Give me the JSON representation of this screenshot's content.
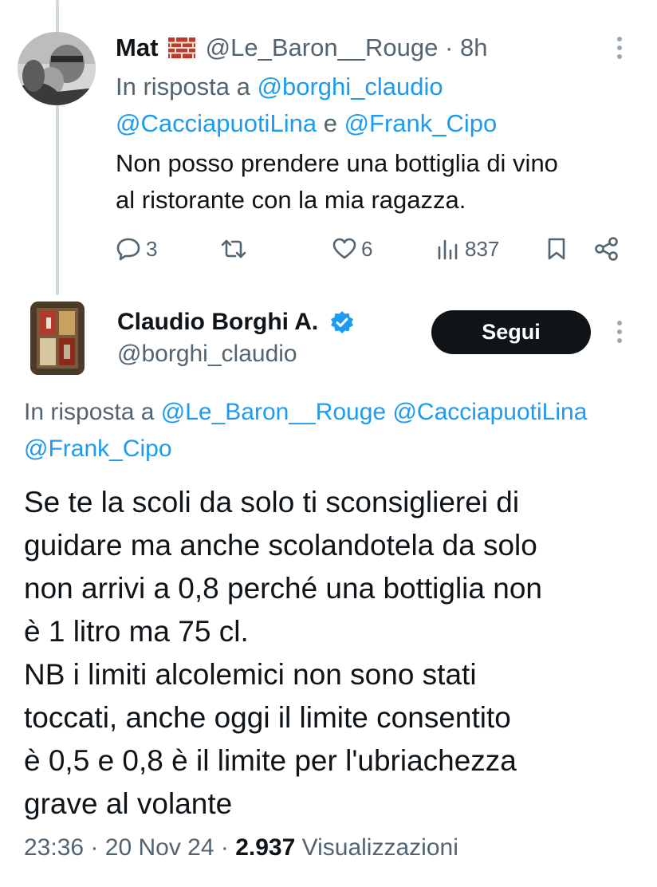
{
  "tweet_reply": {
    "author_name": "Mat",
    "author_emoji_icon": "brick-wall-icon",
    "handle": "@Le_Baron__Rouge",
    "separator": "·",
    "time": "8h",
    "reply_prefix": "In risposta a",
    "reply_user_1": "@borghi_claudio",
    "reply_user_2": "@CacciapuotiLina",
    "reply_conjunction": "e",
    "reply_user_3": "@Frank_Cipo",
    "text_line_1": "Non posso prendere una bottiglia di vino",
    "text_line_2": "al ristorante con la mia ragazza.",
    "stats": {
      "replies": "3",
      "likes": "6",
      "views": "837"
    }
  },
  "main_tweet": {
    "author_name": "Claudio Borghi A.",
    "handle": "@borghi_claudio",
    "follow_label": "Segui",
    "reply_prefix": "In risposta a",
    "reply_user_1": "@Le_Baron__Rouge",
    "reply_user_2": "@CacciapuotiLina",
    "reply_user_3": "@Frank_Cipo",
    "text_lines": [
      "Se te la scoli da solo ti sconsiglierei di",
      "guidare ma anche scolandotela da solo",
      "non arrivi a 0,8 perché una bottiglia non",
      "è 1 litro ma 75 cl.",
      "NB i limiti alcolemici non sono stati",
      "toccati, anche oggi il limite consentito",
      "è 0,5 e 0,8 è il limite per l'ubriachezza",
      "grave al volante"
    ],
    "time": "23:36",
    "separator": "·",
    "date": "20 Nov 24",
    "views_count": "2.937",
    "views_label": "Visualizzazioni"
  },
  "colors": {
    "link": "#1d9bf0",
    "muted": "#536471",
    "text": "#0f1419",
    "button_bg": "#0f1419",
    "thread_line": "#cfd9de"
  }
}
